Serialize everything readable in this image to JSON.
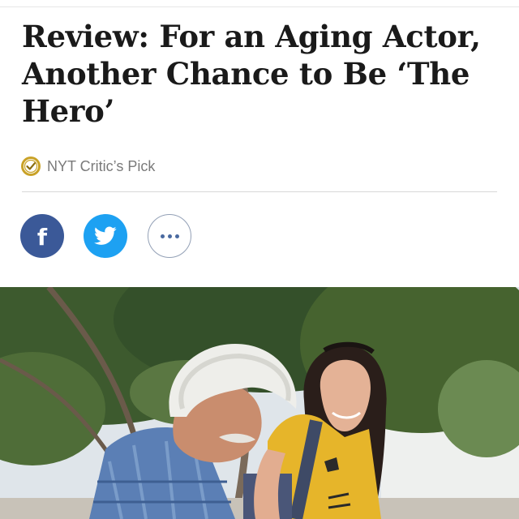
{
  "article": {
    "headline": "Review: For an Aging Actor, Another Chance to Be ‘The Hero’",
    "critics_pick_label": "NYT Critic’s Pick"
  },
  "share": {
    "facebook_glyph": "f",
    "icons": [
      "facebook-icon",
      "twitter-icon",
      "more-icon"
    ]
  },
  "colors": {
    "facebook": "#3b5998",
    "twitter": "#1da1f2",
    "critics_pick_gold": "#c9a227"
  }
}
